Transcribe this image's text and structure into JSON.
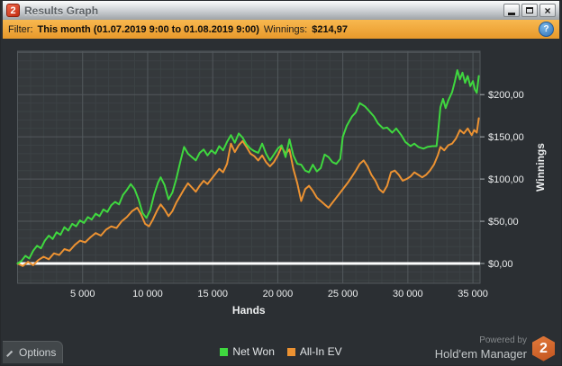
{
  "window": {
    "title": "Results Graph",
    "app_icon_text": "2",
    "controls": {
      "minimize": "minimize",
      "maximize": "maximize",
      "close": "×"
    }
  },
  "filter_bar": {
    "filter_label": "Filter:",
    "filter_value": "This month (01.07.2019 9:00 to 01.08.2019 9:00)",
    "winnings_label": "Winnings:",
    "winnings_value": "$214,97",
    "info_icon_glyph": "?"
  },
  "bottom_bar": {
    "options_label": "Options",
    "powered_by_line1": "Powered by",
    "powered_by_line2": "Hold'em Manager",
    "logo_number": "2"
  },
  "colors": {
    "filter_bar": "#eea33b",
    "plot_bg": "#35393c",
    "outer_bg": "#2b2f33",
    "grid_minor": "#3c4245",
    "grid_major": "#53595d",
    "label": "#eceeef",
    "zero_line": "#ffffff",
    "net_won": "#3fd83f",
    "all_in_ev": "#ec9232",
    "logo_hex": "#d4672d"
  },
  "chart_data": {
    "type": "line",
    "xlabel": "Hands",
    "ylabel": "Winnings",
    "xlim": [
      0,
      35550
    ],
    "ylim": [
      -23,
      251
    ],
    "grid": {
      "minor_x_step": 1000,
      "minor_y_step": 10,
      "major_x_step": 5000,
      "major_y_step": 50,
      "grid_on": true
    },
    "zero_line_value": 0,
    "legend_position": "bottom-center",
    "x_ticks": [
      {
        "value": 5000,
        "label": "5 000"
      },
      {
        "value": 10000,
        "label": "10 000"
      },
      {
        "value": 15000,
        "label": "15 000"
      },
      {
        "value": 20000,
        "label": "20 000"
      },
      {
        "value": 25000,
        "label": "25 000"
      },
      {
        "value": 30000,
        "label": "30 000"
      },
      {
        "value": 35000,
        "label": "35 000"
      }
    ],
    "y_ticks": [
      {
        "value": 0,
        "label": "$0,00"
      },
      {
        "value": 50,
        "label": "$50,00"
      },
      {
        "value": 100,
        "label": "$100,00"
      },
      {
        "value": 150,
        "label": "$150,00"
      },
      {
        "value": 200,
        "label": "$200,00"
      }
    ],
    "series": [
      {
        "name": "Net Won",
        "color": "#3fd83f",
        "points": [
          [
            0,
            0
          ],
          [
            300,
            3
          ],
          [
            600,
            9
          ],
          [
            900,
            6
          ],
          [
            1200,
            15
          ],
          [
            1500,
            21
          ],
          [
            1800,
            18
          ],
          [
            2100,
            27
          ],
          [
            2400,
            33
          ],
          [
            2700,
            29
          ],
          [
            3000,
            37
          ],
          [
            3300,
            34
          ],
          [
            3600,
            43
          ],
          [
            3900,
            39
          ],
          [
            4200,
            47
          ],
          [
            4500,
            44
          ],
          [
            4800,
            51
          ],
          [
            5100,
            48
          ],
          [
            5400,
            55
          ],
          [
            5700,
            52
          ],
          [
            6000,
            59
          ],
          [
            6300,
            56
          ],
          [
            6600,
            64
          ],
          [
            6900,
            61
          ],
          [
            7200,
            69
          ],
          [
            7500,
            73
          ],
          [
            7800,
            70
          ],
          [
            8100,
            81
          ],
          [
            8400,
            87
          ],
          [
            8700,
            94
          ],
          [
            9000,
            88
          ],
          [
            9300,
            76
          ],
          [
            9600,
            60
          ],
          [
            9900,
            54
          ],
          [
            10200,
            63
          ],
          [
            10500,
            82
          ],
          [
            10800,
            96
          ],
          [
            11000,
            102
          ],
          [
            11300,
            93
          ],
          [
            11600,
            76
          ],
          [
            11900,
            84
          ],
          [
            12200,
            100
          ],
          [
            12500,
            120
          ],
          [
            12800,
            138
          ],
          [
            13100,
            130
          ],
          [
            13400,
            126
          ],
          [
            13700,
            122
          ],
          [
            14000,
            131
          ],
          [
            14300,
            135
          ],
          [
            14600,
            128
          ],
          [
            14900,
            134
          ],
          [
            15200,
            130
          ],
          [
            15500,
            139
          ],
          [
            15800,
            134
          ],
          [
            16100,
            144
          ],
          [
            16400,
            152
          ],
          [
            16700,
            143
          ],
          [
            17000,
            154
          ],
          [
            17300,
            149
          ],
          [
            17600,
            141
          ],
          [
            17900,
            136
          ],
          [
            18200,
            133
          ],
          [
            18500,
            131
          ],
          [
            18800,
            142
          ],
          [
            19100,
            130
          ],
          [
            19400,
            122
          ],
          [
            19700,
            129
          ],
          [
            20000,
            136
          ],
          [
            20300,
            140
          ],
          [
            20600,
            126
          ],
          [
            20900,
            147
          ],
          [
            21200,
            128
          ],
          [
            21500,
            118
          ],
          [
            21800,
            117
          ],
          [
            22100,
            110
          ],
          [
            22400,
            108
          ],
          [
            22700,
            117
          ],
          [
            23000,
            109
          ],
          [
            23300,
            113
          ],
          [
            23600,
            129
          ],
          [
            23900,
            126
          ],
          [
            24200,
            120
          ],
          [
            24500,
            118
          ],
          [
            24800,
            124
          ],
          [
            25000,
            150
          ],
          [
            25300,
            163
          ],
          [
            25700,
            174
          ],
          [
            26000,
            179
          ],
          [
            26300,
            190
          ],
          [
            26700,
            186
          ],
          [
            27000,
            181
          ],
          [
            27400,
            174
          ],
          [
            27700,
            166
          ],
          [
            28100,
            160
          ],
          [
            28400,
            161
          ],
          [
            28800,
            155
          ],
          [
            29100,
            160
          ],
          [
            29500,
            152
          ],
          [
            29800,
            144
          ],
          [
            30200,
            139
          ],
          [
            30500,
            142
          ],
          [
            30800,
            138
          ],
          [
            31200,
            136
          ],
          [
            31500,
            138
          ],
          [
            31900,
            139
          ],
          [
            32200,
            139
          ],
          [
            32350,
            160
          ],
          [
            32500,
            185
          ],
          [
            32700,
            195
          ],
          [
            32900,
            184
          ],
          [
            33100,
            193
          ],
          [
            33400,
            203
          ],
          [
            33600,
            215
          ],
          [
            33800,
            229
          ],
          [
            34000,
            218
          ],
          [
            34200,
            226
          ],
          [
            34400,
            214
          ],
          [
            34600,
            222
          ],
          [
            34800,
            210
          ],
          [
            35000,
            216
          ],
          [
            35150,
            206
          ],
          [
            35300,
            202
          ],
          [
            35450,
            222
          ]
        ]
      },
      {
        "name": "All-In EV",
        "color": "#ec9232",
        "points": [
          [
            0,
            0
          ],
          [
            400,
            -3
          ],
          [
            800,
            2
          ],
          [
            1200,
            -2
          ],
          [
            1600,
            4
          ],
          [
            2000,
            8
          ],
          [
            2400,
            5
          ],
          [
            2800,
            12
          ],
          [
            3200,
            10
          ],
          [
            3600,
            17
          ],
          [
            4000,
            15
          ],
          [
            4400,
            22
          ],
          [
            4800,
            27
          ],
          [
            5200,
            25
          ],
          [
            5600,
            31
          ],
          [
            6000,
            36
          ],
          [
            6400,
            33
          ],
          [
            6800,
            40
          ],
          [
            7200,
            44
          ],
          [
            7600,
            42
          ],
          [
            8000,
            50
          ],
          [
            8400,
            55
          ],
          [
            8800,
            62
          ],
          [
            9200,
            66
          ],
          [
            9500,
            58
          ],
          [
            9800,
            47
          ],
          [
            10100,
            44
          ],
          [
            10400,
            52
          ],
          [
            10700,
            62
          ],
          [
            11000,
            70
          ],
          [
            11300,
            64
          ],
          [
            11600,
            56
          ],
          [
            11900,
            62
          ],
          [
            12200,
            72
          ],
          [
            12500,
            80
          ],
          [
            12800,
            88
          ],
          [
            13100,
            95
          ],
          [
            13400,
            90
          ],
          [
            13700,
            85
          ],
          [
            14000,
            92
          ],
          [
            14300,
            98
          ],
          [
            14600,
            94
          ],
          [
            14900,
            100
          ],
          [
            15200,
            106
          ],
          [
            15500,
            112
          ],
          [
            15800,
            108
          ],
          [
            16100,
            118
          ],
          [
            16400,
            142
          ],
          [
            16700,
            132
          ],
          [
            17000,
            140
          ],
          [
            17300,
            145
          ],
          [
            17600,
            138
          ],
          [
            17900,
            130
          ],
          [
            18200,
            127
          ],
          [
            18500,
            122
          ],
          [
            18800,
            128
          ],
          [
            19100,
            120
          ],
          [
            19400,
            115
          ],
          [
            19700,
            120
          ],
          [
            20000,
            128
          ],
          [
            20300,
            138
          ],
          [
            20600,
            130
          ],
          [
            20900,
            135
          ],
          [
            21200,
            112
          ],
          [
            21500,
            95
          ],
          [
            21800,
            74
          ],
          [
            22100,
            88
          ],
          [
            22400,
            92
          ],
          [
            22700,
            86
          ],
          [
            23000,
            78
          ],
          [
            23300,
            74
          ],
          [
            23600,
            70
          ],
          [
            23900,
            66
          ],
          [
            24200,
            72
          ],
          [
            24500,
            78
          ],
          [
            24800,
            84
          ],
          [
            25100,
            90
          ],
          [
            25400,
            96
          ],
          [
            25700,
            103
          ],
          [
            26000,
            110
          ],
          [
            26300,
            118
          ],
          [
            26600,
            122
          ],
          [
            26900,
            115
          ],
          [
            27200,
            105
          ],
          [
            27500,
            98
          ],
          [
            27800,
            88
          ],
          [
            28100,
            84
          ],
          [
            28400,
            92
          ],
          [
            28700,
            108
          ],
          [
            29000,
            110
          ],
          [
            29300,
            105
          ],
          [
            29600,
            98
          ],
          [
            29900,
            100
          ],
          [
            30200,
            103
          ],
          [
            30500,
            108
          ],
          [
            30800,
            105
          ],
          [
            31100,
            102
          ],
          [
            31400,
            105
          ],
          [
            31700,
            110
          ],
          [
            32000,
            117
          ],
          [
            32300,
            128
          ],
          [
            32500,
            138
          ],
          [
            32800,
            134
          ],
          [
            33100,
            140
          ],
          [
            33400,
            142
          ],
          [
            33700,
            148
          ],
          [
            34000,
            158
          ],
          [
            34300,
            154
          ],
          [
            34600,
            160
          ],
          [
            34900,
            152
          ],
          [
            35100,
            158
          ],
          [
            35300,
            155
          ],
          [
            35450,
            172
          ]
        ]
      }
    ]
  }
}
